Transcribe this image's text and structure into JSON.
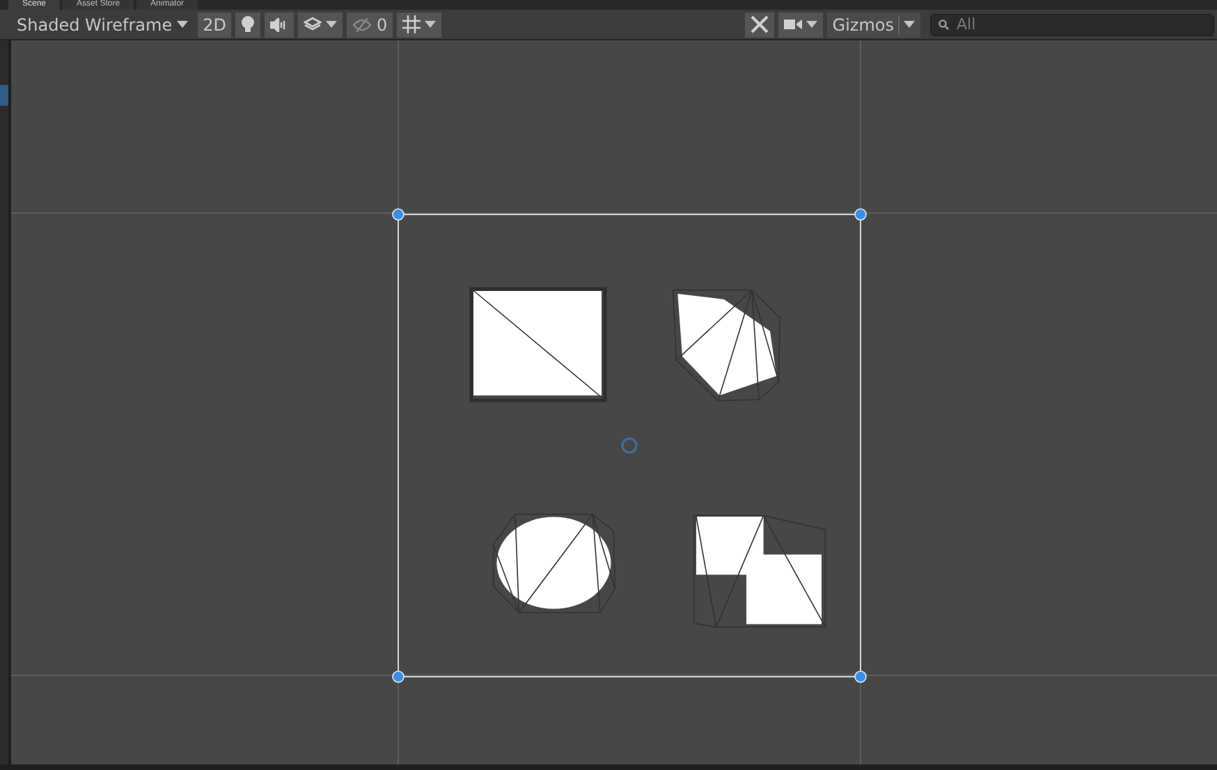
{
  "tabs": [
    {
      "label": "Scene",
      "selected": true
    },
    {
      "label": "Asset Store",
      "selected": false
    },
    {
      "label": "Animator",
      "selected": false
    }
  ],
  "toolbar": {
    "draw_mode": "Shaded Wireframe",
    "mode_2d": "2D",
    "hidden_count": "0",
    "gizmos": "Gizmos",
    "search": {
      "placeholder": "All"
    }
  }
}
